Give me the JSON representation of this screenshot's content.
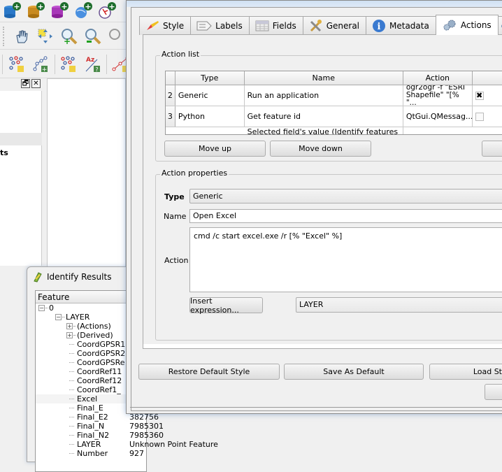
{
  "main_window": {
    "toolbar_rows": [
      [
        "add-postgis-layer-icon",
        "add-spatialite-layer-icon",
        "add-mssql-layer-icon",
        "add-wms-layer-icon",
        "add-wfs-layer-icon"
      ],
      [
        "pan-map-icon",
        "pan-to-selection-icon",
        "zoom-in-icon",
        "zoom-out-icon",
        "zoom-full-icon"
      ],
      [
        "select-features-icon",
        "add-vertex-icon",
        "select-by-expression-icon",
        "label-tool-icon",
        "measure-line-icon"
      ]
    ],
    "dock_partial_text": "ts",
    "dock_float_glyph": "🗗",
    "dock_close_glyph": "✕"
  },
  "identify_results": {
    "title": "Identify Results",
    "column_header": "Feature",
    "tree": [
      {
        "level": 0,
        "expander": "−",
        "label": "0",
        "value": ""
      },
      {
        "level": 1,
        "expander": "−",
        "label": "LAYER",
        "value": ""
      },
      {
        "level": 2,
        "expander": "+",
        "label": "(Actions)",
        "value": ""
      },
      {
        "level": 2,
        "expander": "+",
        "label": "(Derived)",
        "value": ""
      },
      {
        "level": 2,
        "expander": "",
        "label": "CoordGPSR1",
        "value": ""
      },
      {
        "level": 2,
        "expander": "",
        "label": "CoordGPSR2",
        "value": ""
      },
      {
        "level": 2,
        "expander": "",
        "label": "CoordGPSRe",
        "value": ""
      },
      {
        "level": 2,
        "expander": "",
        "label": "CoordRef11",
        "value": ""
      },
      {
        "level": 2,
        "expander": "",
        "label": "CoordRef12",
        "value": ""
      },
      {
        "level": 2,
        "expander": "",
        "label": "CoordRef1_",
        "value": ""
      },
      {
        "level": 2,
        "expander": "",
        "label": "Excel",
        "value": ""
      },
      {
        "level": 2,
        "expander": "",
        "label": "Final_E",
        "value": ""
      },
      {
        "level": 2,
        "expander": "",
        "label": "Final_E2",
        "value": "382756"
      },
      {
        "level": 2,
        "expander": "",
        "label": "Final_N",
        "value": "7985301"
      },
      {
        "level": 2,
        "expander": "",
        "label": "Final_N2",
        "value": "7985360"
      },
      {
        "level": 2,
        "expander": "",
        "label": "LAYER",
        "value": "Unknown Point Feature"
      },
      {
        "level": 2,
        "expander": "",
        "label": "Number",
        "value": "927"
      }
    ]
  },
  "layer_properties": {
    "tabs": [
      {
        "label": "Style",
        "icon": "style-brush-icon",
        "active": false
      },
      {
        "label": "Labels",
        "icon": "labels-icon",
        "active": false
      },
      {
        "label": "Fields",
        "icon": "fields-table-icon",
        "active": false
      },
      {
        "label": "General",
        "icon": "general-tools-icon",
        "active": false
      },
      {
        "label": "Metadata",
        "icon": "metadata-info-icon",
        "active": false
      },
      {
        "label": "Actions",
        "icon": "actions-gears-icon",
        "active": true
      }
    ],
    "action_list": {
      "title": "Action list",
      "columns": [
        "Type",
        "Name",
        "Action",
        ""
      ],
      "rows": [
        {
          "num": "2",
          "type": "Generic",
          "name": "Run an application",
          "action": "ogr2ogr -f \"ESRI Shapefile\" \"[% \"...",
          "capture": true
        },
        {
          "num": "3",
          "type": "Python",
          "name": "Get feature id",
          "action": "QtGui.QMessag...",
          "capture": false
        },
        {
          "num": "",
          "type": "",
          "name": "Selected field's value (Identify features",
          "action": "",
          "capture": false
        }
      ],
      "move_up_label": "Move up",
      "move_down_label": "Move down"
    },
    "action_properties": {
      "title": "Action properties",
      "type_label": "Type",
      "type_value": "Generic",
      "name_label": "Name",
      "name_value": "Open Excel",
      "action_label": "Action",
      "action_value": "cmd /c start excel.exe /r  [% \"Excel\" %]",
      "insert_expression_label": "Insert expression...",
      "field_combo_value": "LAYER"
    },
    "buttons": {
      "restore_default_style": "Restore Default Style",
      "save_as_default": "Save As Default",
      "load_style": "Load St"
    }
  }
}
